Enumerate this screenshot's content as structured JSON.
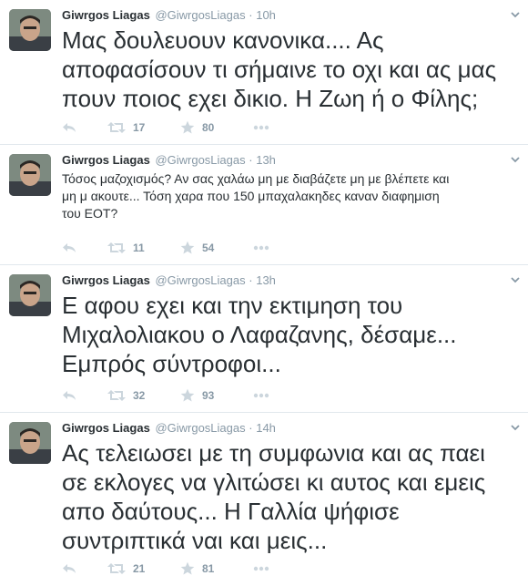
{
  "tweets": [
    {
      "fullname": "Giwrgos Liagas",
      "username": "@GiwrgosLiagas",
      "dot": "·",
      "time": "10h",
      "lines": [
        "Μας δουλευουν κανονικα.... Ας",
        "αποφασίσουν τι σήμαινε το οχι και ας μας",
        "πουν ποιος εχει δικιο. Η Ζωη ή ο Φίλης;"
      ],
      "retweets": "17",
      "favorites": "80"
    },
    {
      "fullname": "Giwrgos Liagas",
      "username": "@GiwrgosLiagas",
      "dot": "·",
      "time": "13h",
      "lines": [
        "Τόσος μαζοχισμός? Αν σας χαλάω μη με διαβάζετε μη με βλέπετε και",
        "μη μ ακουτε... Τόση χαρα που 150 μπαχαλακηδες καναν διαφημιση",
        "του ΕΟΤ?"
      ],
      "retweets": "11",
      "favorites": "54"
    },
    {
      "fullname": "Giwrgos Liagas",
      "username": "@GiwrgosLiagas",
      "dot": "·",
      "time": "13h",
      "lines": [
        "Ε αφου εχει και την εκτιμηση του",
        "Μιχαλολιακου ο Λαφαζανης, δέσαμε...",
        "Εμπρός σύντροφοι..."
      ],
      "retweets": "32",
      "favorites": "93"
    },
    {
      "fullname": "Giwrgos Liagas",
      "username": "@GiwrgosLiagas",
      "dot": "·",
      "time": "14h",
      "lines": [
        "Ας τελειωσει με τη συμφωνια και ας παει",
        "σε εκλογες να γλιτώσει κι αυτος και εμεις",
        "απο δαύτους... Η Γαλλία ψήφισε",
        "συντριπτικά ναι και μεις..."
      ],
      "retweets": "21",
      "favorites": "81"
    }
  ],
  "colors": {
    "text": "#292f33",
    "meta": "#8899a6",
    "divider": "#e1e8ed"
  },
  "icons": {
    "reply": "reply-icon",
    "retweet": "retweet-icon",
    "favorite": "star-icon",
    "more": "more-dots-icon",
    "caret": "chevron-down-icon"
  }
}
